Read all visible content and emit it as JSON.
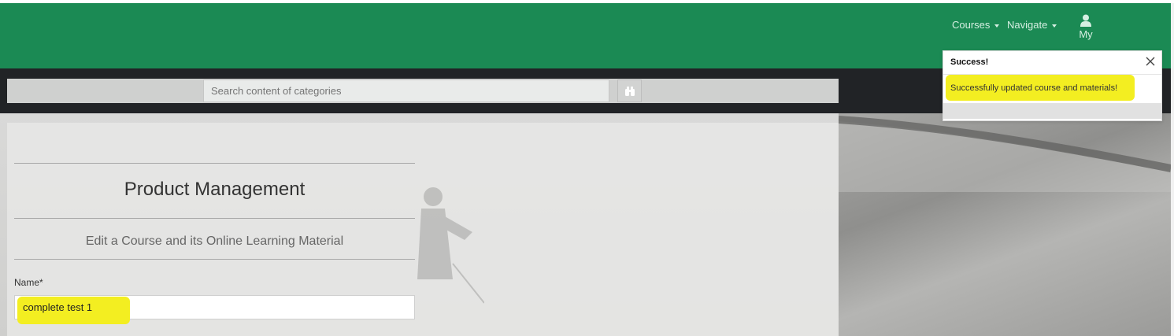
{
  "header": {
    "nav": [
      {
        "label": "Courses"
      },
      {
        "label": "Navigate"
      }
    ],
    "user_label": "My",
    "brand_color": "#1b8a54"
  },
  "search": {
    "placeholder": "Search content of categories",
    "button_icon": "binoculars-icon"
  },
  "page": {
    "title": "Product Management",
    "subtitle": "Edit a Course and its Online Learning Material",
    "fields": [
      {
        "label": "Name*",
        "value": "complete test 1"
      }
    ]
  },
  "toast": {
    "title": "Success!",
    "message": "Successfully updated course and materials!",
    "close_icon": "close-icon"
  },
  "highlight_color": "#f3ee21"
}
